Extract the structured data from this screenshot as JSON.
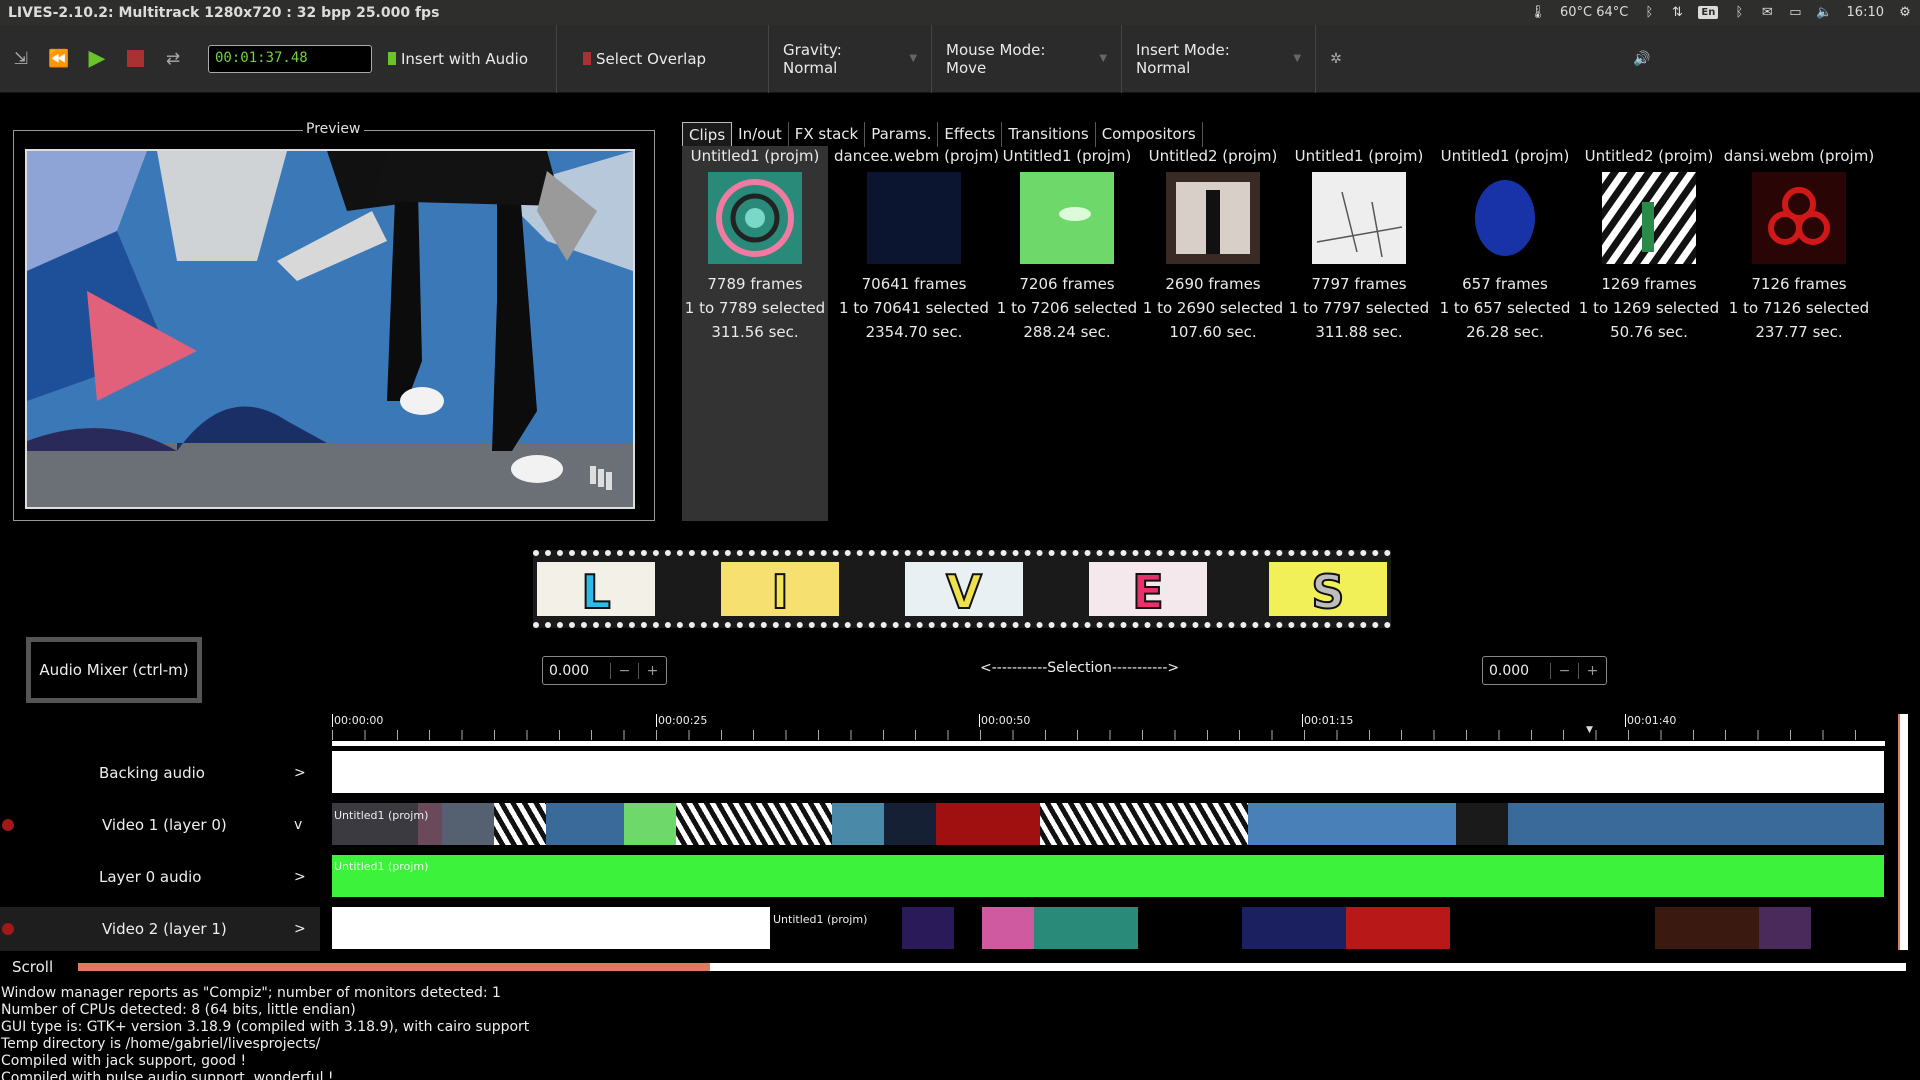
{
  "window": {
    "title": "LIVES-2.10.2: Multitrack 1280x720 : 32 bpp 25.000 fps"
  },
  "systray": {
    "temperature": "60°C 64°C",
    "keyboard": "En",
    "clock": "16:10",
    "icons": [
      "thermometer-icon",
      "bluetooth-icon",
      "network-icon",
      "keyboard-icon",
      "bluetooth-icon",
      "mail-icon",
      "battery-icon",
      "volume-icon",
      "clock",
      "gear-icon"
    ]
  },
  "toolbar": {
    "timecode": "00:01:37.48",
    "insert_with_audio": "Insert with Audio",
    "select_overlap": "Select Overlap",
    "gravity": "Gravity: Normal",
    "mouse_mode": "Mouse Mode: Move",
    "insert_mode": "Insert Mode: Normal"
  },
  "preview": {
    "label": "Preview"
  },
  "tabs": [
    "Clips",
    "In/out",
    "FX stack",
    "Params.",
    "Effects",
    "Transitions",
    "Compositors"
  ],
  "clips": [
    {
      "name": "Untitled1 (projm)",
      "frames": "7789 frames",
      "range": "1 to 7789 selected",
      "duration": "311.56 sec.",
      "color": "#2a8a7a"
    },
    {
      "name": "dancee.webm (projm)",
      "frames": "70641 frames",
      "range": "1 to 70641 selected",
      "duration": "2354.70 sec.",
      "color": "#0b1530"
    },
    {
      "name": "Untitled1 (projm)",
      "frames": "7206 frames",
      "range": "1 to 7206 selected",
      "duration": "288.24 sec.",
      "color": "#6fd86a"
    },
    {
      "name": "Untitled2 (projm)",
      "frames": "2690 frames",
      "range": "1 to 2690 selected",
      "duration": "107.60 sec.",
      "color": "#3a2a25"
    },
    {
      "name": "Untitled1 (projm)",
      "frames": "7797 frames",
      "range": "1 to 7797 selected",
      "duration": "311.88 sec.",
      "color": "#eeeeee"
    },
    {
      "name": "Untitled1 (projm)",
      "frames": "657 frames",
      "range": "1 to 657 selected",
      "duration": "26.28 sec.",
      "color": "#1833a8"
    },
    {
      "name": "Untitled2 (projm)",
      "frames": "1269 frames",
      "range": "1 to 1269 selected",
      "duration": "50.76 sec.",
      "color": "#888888"
    },
    {
      "name": "dansi.webm (projm)",
      "frames": "7126 frames",
      "range": "1 to 7126 selected",
      "duration": "237.77 sec.",
      "color": "#2a0505"
    }
  ],
  "logo_letters": [
    "L",
    "I",
    "V",
    "E",
    "S"
  ],
  "audio_mixer": "Audio Mixer (ctrl-m)",
  "selection": {
    "start": "0.000",
    "end": "0.000",
    "label": "<-----------Selection----------->"
  },
  "ruler": [
    "00:00:00",
    "00:00:25",
    "00:00:50",
    "00:01:15",
    "00:01:40"
  ],
  "tracks": [
    {
      "label": "Backing audio",
      "expander": ">"
    },
    {
      "label": "Video 1 (layer 0)",
      "expander": "v"
    },
    {
      "label": "Layer 0 audio",
      "expander": ">"
    },
    {
      "label": "Video 2 (layer 1)",
      "expander": ">"
    }
  ],
  "track_clip_labels": {
    "v1": "Untitled1 (projm)",
    "a0": "Untitled1 (projm)",
    "v2": "Untitled1 (projm)"
  },
  "scroll_label": "Scroll",
  "console": [
    "Window manager reports as \"Compiz\"; number of monitors detected: 1",
    "Number of CPUs detected: 8 (64 bits, little endian)",
    "GUI type is: GTK+ version 3.18.9 (compiled with 3.18.9), with cairo support",
    "Temp directory is /home/gabriel/livesprojects/",
    "Compiled with jack support, good !",
    "Compiled with pulse audio support, wonderful !"
  ]
}
